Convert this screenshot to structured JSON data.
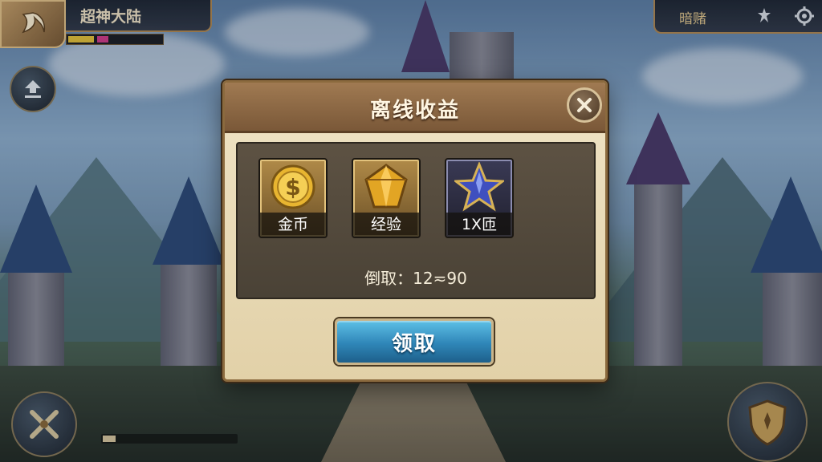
{
  "header": {
    "server_name": "超神大陆",
    "hp_segments": [
      {
        "color": "#e6c23a",
        "fraction": 0.28
      },
      {
        "color": "#d23c8a",
        "fraction": 0.12
      }
    ]
  },
  "topright": {
    "text": "暗赌",
    "icons": [
      "fleur-icon",
      "gear-icon"
    ]
  },
  "dialog": {
    "title": "离线收益",
    "rewards": [
      {
        "icon": "gold-coin-icon",
        "label": "金币"
      },
      {
        "icon": "exp-gem-icon",
        "label": "经验"
      },
      {
        "icon": "blue-star-icon",
        "label": "1X匝"
      }
    ],
    "time_label": "倒取：",
    "time_value": "12≂90",
    "claim_label": "领取"
  },
  "colors": {
    "accent_gold": "#b28a54",
    "button_blue": "#2f86b8",
    "panel_bg": "#4a4236"
  },
  "bottom": {
    "left_button_icon": "crossed-swords-icon",
    "right_button_icon": "shield-icon",
    "upload_icon": "upload-icon"
  }
}
